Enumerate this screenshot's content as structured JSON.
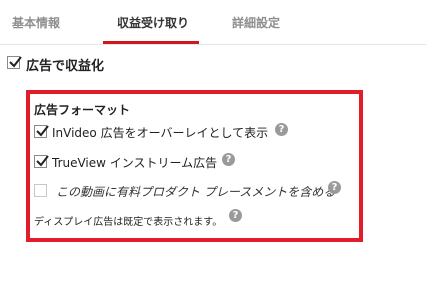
{
  "tabs": [
    {
      "label": "基本情報"
    },
    {
      "label": "収益受け取り"
    },
    {
      "label": "詳細設定"
    }
  ],
  "monetize": {
    "label": "広告で収益化",
    "checked": true
  },
  "ad_formats": {
    "title": "広告フォーマット",
    "options": [
      {
        "label": "InVideo 広告をオーバーレイとして表示",
        "checked": true,
        "enabled": true
      },
      {
        "label": "TrueView インストリーム広告",
        "checked": true,
        "enabled": true
      },
      {
        "label": "この動画に有料プロダクト プレースメントを含める",
        "checked": false,
        "enabled": false
      }
    ],
    "note": "ディスプレイ広告は既定で表示されます。"
  },
  "help_icon": {
    "glyph": "?"
  },
  "colors": {
    "accent": "#cc181e",
    "highlight_box": "#e31c2a"
  }
}
